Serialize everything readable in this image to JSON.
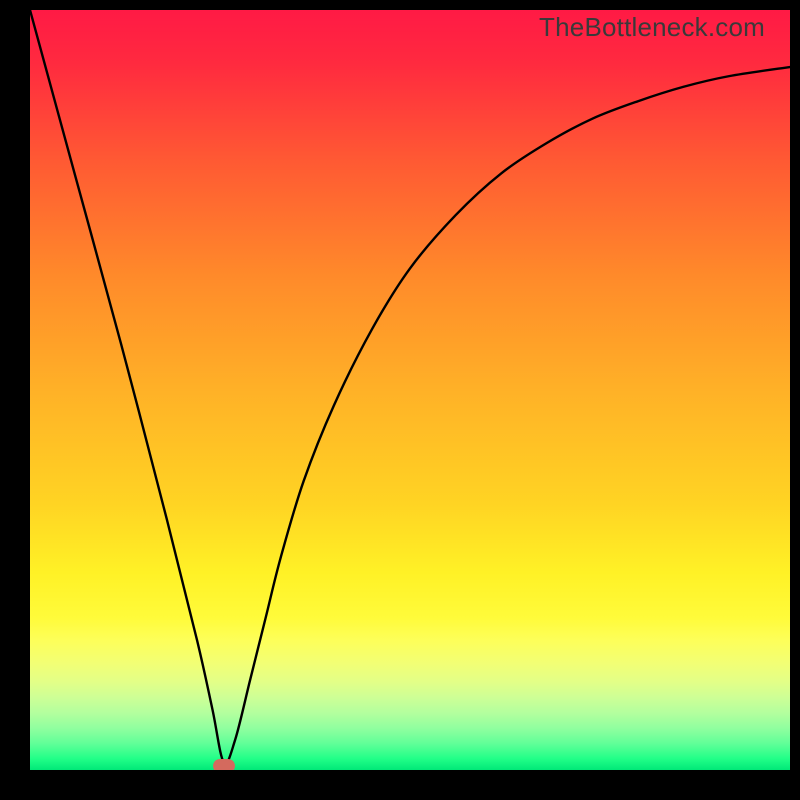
{
  "watermark": "TheBottleneck.com",
  "chart_data": {
    "type": "line",
    "title": "",
    "xlabel": "",
    "ylabel": "",
    "xlim": [
      0,
      100
    ],
    "ylim": [
      0,
      100
    ],
    "grid": false,
    "legend": false,
    "gradient_stops": [
      {
        "offset": 0.0,
        "color": "#ff1a45"
      },
      {
        "offset": 0.07,
        "color": "#ff2a3f"
      },
      {
        "offset": 0.2,
        "color": "#ff5a33"
      },
      {
        "offset": 0.35,
        "color": "#ff8a2a"
      },
      {
        "offset": 0.5,
        "color": "#ffb127"
      },
      {
        "offset": 0.65,
        "color": "#ffd423"
      },
      {
        "offset": 0.74,
        "color": "#fff126"
      },
      {
        "offset": 0.8,
        "color": "#fffb3a"
      },
      {
        "offset": 0.83,
        "color": "#fdff5a"
      },
      {
        "offset": 0.86,
        "color": "#f2ff75"
      },
      {
        "offset": 0.885,
        "color": "#e2ff88"
      },
      {
        "offset": 0.905,
        "color": "#cdff96"
      },
      {
        "offset": 0.925,
        "color": "#b3ff9e"
      },
      {
        "offset": 0.945,
        "color": "#90ff9f"
      },
      {
        "offset": 0.965,
        "color": "#61ff98"
      },
      {
        "offset": 0.985,
        "color": "#22ff88"
      },
      {
        "offset": 1.0,
        "color": "#00e878"
      }
    ],
    "series": [
      {
        "name": "bottleneck-curve",
        "type": "line",
        "color": "#000000",
        "x": [
          0,
          6,
          12,
          18,
          22,
          24,
          25.5,
          27,
          29,
          31,
          33,
          36,
          40,
          45,
          50,
          56,
          62,
          68,
          74,
          80,
          86,
          92,
          100
        ],
        "values": [
          100,
          78,
          56,
          33,
          17,
          8,
          1,
          4,
          12,
          20,
          28,
          38,
          48,
          58,
          66,
          73,
          78.5,
          82.5,
          85.7,
          88,
          89.9,
          91.3,
          92.5
        ]
      }
    ],
    "marker": {
      "x": 25.5,
      "y": 0.5,
      "color": "#d46a5e"
    }
  }
}
